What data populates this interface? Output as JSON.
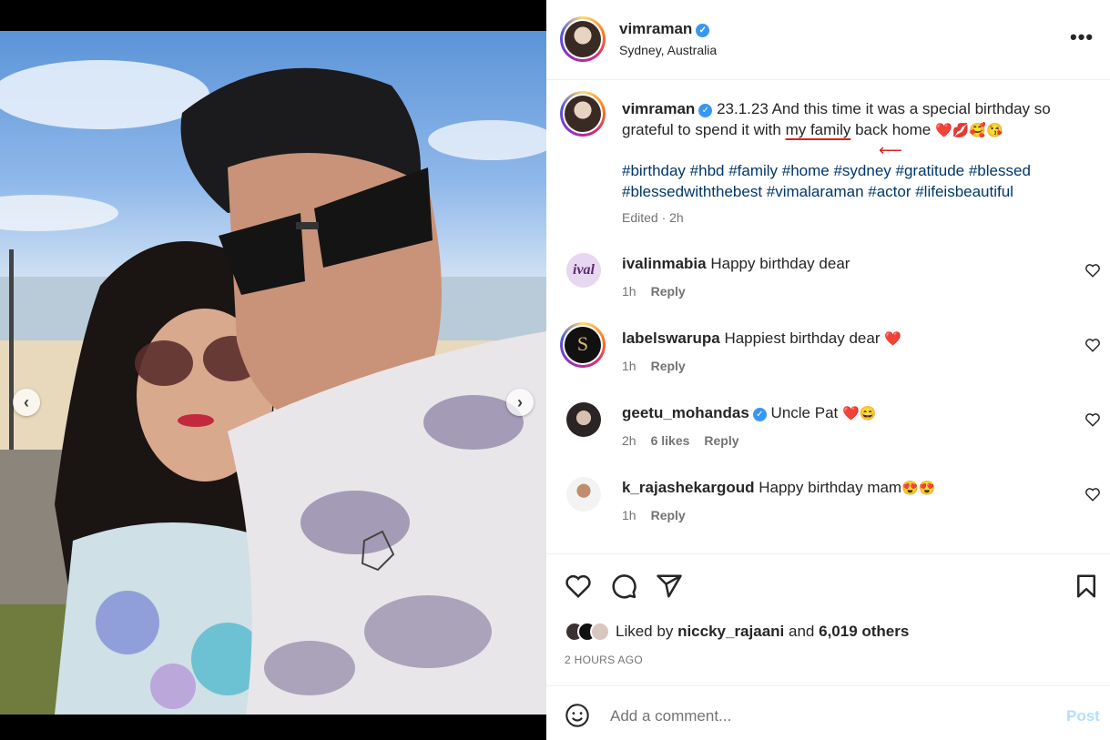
{
  "post": {
    "username": "vimraman",
    "location": "Sydney, Australia",
    "caption_date": "23.1.23",
    "caption_part1": "And this time it was a special birthday so grateful to spend it with",
    "caption_highlight": "my family",
    "caption_part2": "back home",
    "caption_emojis": "❤️💋🥰😘",
    "hashtags": "#birthday #hbd #family #home #sydney #gratitude #blessed #blessedwiththebest #vimalaraman #actor #lifeisbeautiful",
    "edited": "Edited · 2h"
  },
  "comments": [
    {
      "user": "ivalinmabia",
      "text": "Happy birthday dear",
      "time": "1h",
      "likes": "",
      "reply": "Reply",
      "avatar_text": "ival"
    },
    {
      "user": "labelswarupa",
      "text": "Happiest birthday dear",
      "emoji": "❤️",
      "time": "1h",
      "likes": "",
      "reply": "Reply",
      "avatar_text": "S"
    },
    {
      "user": "geetu_mohandas",
      "text": "Uncle Pat",
      "emoji": "❤️😄",
      "time": "2h",
      "likes": "6 likes",
      "reply": "Reply"
    },
    {
      "user": "k_rajashekargoud",
      "text": "Happy birthday mam",
      "emoji": "😍😍",
      "time": "1h",
      "likes": "",
      "reply": "Reply"
    }
  ],
  "likes": {
    "prefix": "Liked by",
    "user": "niccky_rajaani",
    "joiner": "and",
    "others": "6,019 others"
  },
  "timestamp": "2 HOURS AGO",
  "add_comment": {
    "placeholder": "Add a comment...",
    "post": "Post"
  },
  "nav": {
    "prev": "‹",
    "next": "›"
  },
  "icons": [
    "heart-icon",
    "comment-icon",
    "share-icon",
    "bookmark-icon",
    "smile-icon",
    "more-icon",
    "verified-icon"
  ],
  "colors": {
    "link": "#00376b",
    "muted": "#737373",
    "post_disabled": "#b2dffc",
    "verified": "#3897f0",
    "annotation": "#e02020"
  }
}
